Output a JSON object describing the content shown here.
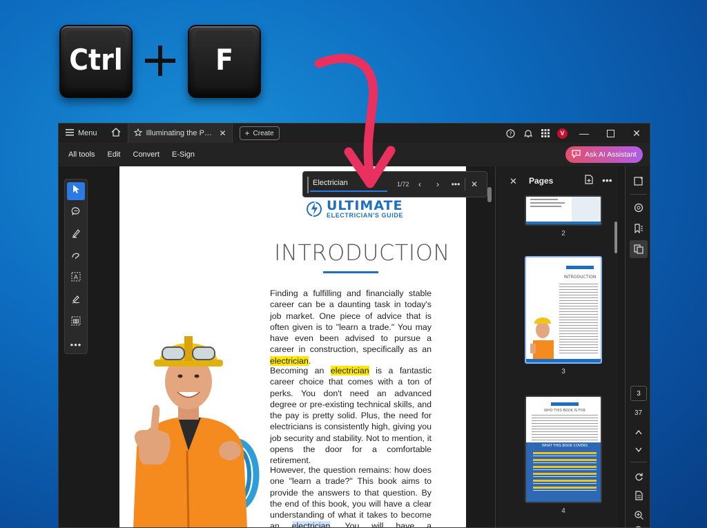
{
  "keys": {
    "ctrl": "Ctrl",
    "f": "F"
  },
  "titlebar": {
    "menu_label": "Menu",
    "tab_title": "Illuminating the Path: A...",
    "create_label": "Create",
    "avatar_letter": "V"
  },
  "menubar": {
    "items": [
      "All tools",
      "Edit",
      "Convert",
      "E-Sign"
    ],
    "ai_button": "Ask AI Assistant"
  },
  "find": {
    "query": "Electrician",
    "count": "1/72"
  },
  "document": {
    "logo_title": "ULTIMATE",
    "logo_subtitle": "ELECTRICIAN'S GUIDE",
    "heading": "INTRODUCTION",
    "p1_before": "Finding a fulfilling and financially stable career can be a daunting task in today's job market. One piece of advice that is often given is to \"learn a trade.\" You may have even been advised to pursue a career in construction, specifically as an ",
    "p1_hl": "electrician",
    "p1_after": ".",
    "p2_before": "Becoming an ",
    "p2_hl": "electrician",
    "p2_after": " is a fantastic career choice that comes with a ton of perks. You don't need an advanced degree or pre-existing technical skills, and the pay is pretty solid. Plus, the need for electricians is consistently high, giving you job security and stability. Not to mention, it opens the door for a comfortable retirement.",
    "p3_before": "However, the question remains: how does one \"learn a trade?\" This book aims to provide the answers to that question. By the end of this book, you will have a clear understanding of what it takes to become an ",
    "p3_hl": "electrician",
    "p3_after": ". You will have a comprehensive"
  },
  "pages_panel": {
    "title": "Pages",
    "thumb_labels": [
      "2",
      "3",
      "4"
    ],
    "thumb3_heading": "INTRODUCTION",
    "thumb4_heading": "WHO THIS BOOK IS FOR",
    "thumb4_band": "WHAT THIS BOOK COVERS"
  },
  "nav": {
    "current_page": "3",
    "total_pages": "37"
  },
  "colors": {
    "accent": "#2c7be5",
    "highlight": "#ffe800",
    "arrow": "#e8315f",
    "brand": "#1f6fc1"
  }
}
